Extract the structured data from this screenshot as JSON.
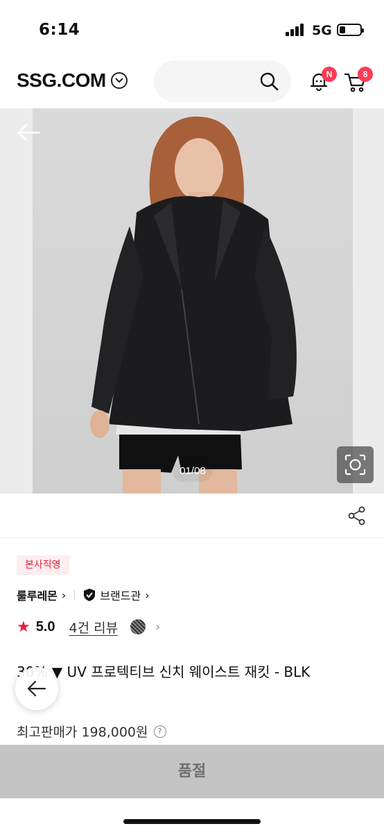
{
  "status_bar": {
    "time": "6:14",
    "network": "5G"
  },
  "header": {
    "logo": "SSG.COM",
    "notification_badge": "N",
    "cart_badge": "8"
  },
  "gallery": {
    "counter": "01/08"
  },
  "product": {
    "official_badge": "본사직영",
    "brand": "룰루레몬",
    "brand_hall": "브랜드관",
    "rating": "5.0",
    "review_count": "4건 리뷰",
    "name": "30% ▼  UV 프로텍티브 신치 웨이스트 재킷 - BLK",
    "price_label": "최고판매가 198,000원"
  },
  "action": {
    "soldout_label": "품절"
  },
  "colors": {
    "accent": "#e4203b",
    "badge": "#ff3b55",
    "soldout_bg": "#c4c4c4"
  }
}
